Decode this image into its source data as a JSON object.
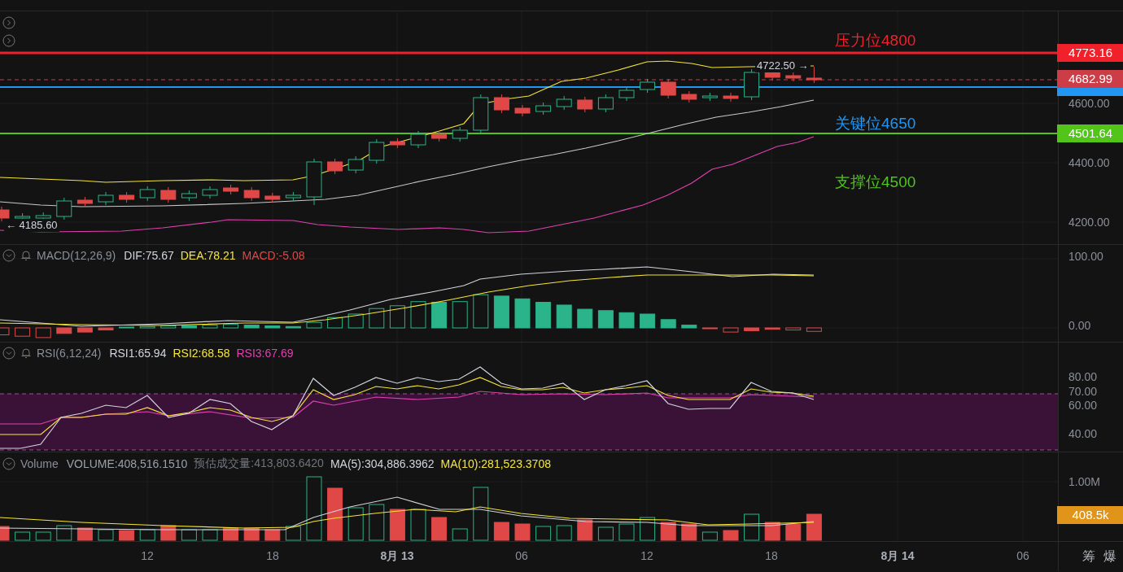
{
  "price_panel": {
    "levels": [
      {
        "label": "压力位4800",
        "color": "#f0212b"
      },
      {
        "label": "关键位4650",
        "color": "#2196f3"
      },
      {
        "label": "支撑位4500",
        "color": "#4fc41e"
      }
    ],
    "high_label": "4722.50 →",
    "low_label": "← 4185.60",
    "axis": [
      "4600.00",
      "4400.00",
      "4200.00"
    ],
    "tags": [
      {
        "text": "4773.16",
        "color": "#f0212b"
      },
      {
        "text": "4682.99",
        "color": "#cc3d48"
      },
      {
        "text": "4501.64",
        "color": "#52c41a"
      }
    ]
  },
  "macd": {
    "title": "MACD(12,26,9)",
    "values": [
      {
        "text": "DIF:75.67",
        "color": "#d1d4dc"
      },
      {
        "text": "DEA:78.21",
        "color": "#f5e536"
      },
      {
        "text": "MACD:-5.08",
        "color": "#e04848"
      }
    ],
    "axis": [
      "100.00",
      "0.00"
    ]
  },
  "rsi": {
    "title": "RSI(6,12,24)",
    "values": [
      {
        "text": "RSI1:65.94",
        "color": "#d1d4dc"
      },
      {
        "text": "RSI2:68.58",
        "color": "#f5e536"
      },
      {
        "text": "RSI3:67.69",
        "color": "#e040b0"
      }
    ],
    "axis": [
      "80.00",
      "70.00",
      "60.00",
      "40.00"
    ]
  },
  "volume": {
    "title": "Volume",
    "values": [
      {
        "text": "VOLUME:408,516.1510",
        "color": "#9aa0aa"
      },
      {
        "text": "预估成交量:413,803.6420",
        "color": "#6f747c"
      },
      {
        "text": "MA(5):304,886.3962",
        "color": "#d1d4dc"
      },
      {
        "text": "MA(10):281,523.3708",
        "color": "#f5e536"
      }
    ],
    "axis": [
      "1.00M"
    ],
    "tag": {
      "text": "408.5k",
      "color": "#e0951a"
    }
  },
  "time_axis": [
    {
      "label": "12",
      "bold": false
    },
    {
      "label": "18",
      "bold": false
    },
    {
      "label": "8月 13",
      "bold": true
    },
    {
      "label": "06",
      "bold": false
    },
    {
      "label": "12",
      "bold": false
    },
    {
      "label": "18",
      "bold": false
    },
    {
      "label": "8月 14",
      "bold": true
    },
    {
      "label": "06",
      "bold": false
    }
  ],
  "corner_tools": [
    "筹",
    "爆"
  ]
}
